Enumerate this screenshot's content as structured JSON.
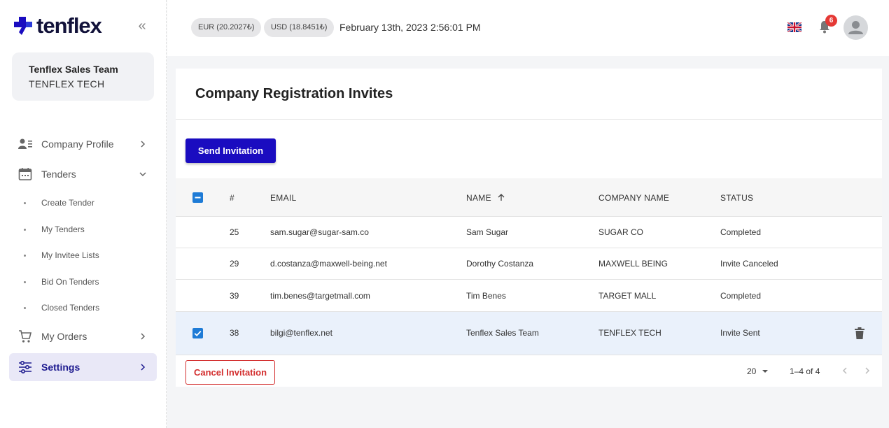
{
  "brand": {
    "name": "tenflex"
  },
  "team": {
    "name": "Tenflex Sales Team",
    "company": "TENFLEX TECH"
  },
  "nav": {
    "company_profile": "Company Profile",
    "tenders": "Tenders",
    "tender_sub": [
      "Create Tender",
      "My Tenders",
      "My Invitee Lists",
      "Bid On Tenders",
      "Closed Tenders"
    ],
    "my_orders": "My Orders",
    "settings": "Settings"
  },
  "topbar": {
    "eur": "EUR (20.2027₺)",
    "usd": "USD (18.8451₺)",
    "datetime": "February 13th, 2023 2:56:01 PM",
    "notification_count": "6"
  },
  "page": {
    "title": "Company Registration Invites",
    "send_label": "Send Invitation",
    "cancel_label": "Cancel Invitation"
  },
  "table": {
    "headers": {
      "num": "#",
      "email": "EMAIL",
      "name": "NAME",
      "company": "COMPANY NAME",
      "status": "STATUS"
    },
    "rows": [
      {
        "num": "25",
        "email": "sam.sugar@sugar-sam.co",
        "name": "Sam Sugar",
        "company": "SUGAR CO",
        "status": "Completed"
      },
      {
        "num": "29",
        "email": "d.costanza@maxwell-being.net",
        "name": "Dorothy Costanza",
        "company": "MAXWELL BEING",
        "status": "Invite Canceled"
      },
      {
        "num": "39",
        "email": "tim.benes@targetmall.com",
        "name": "Tim Benes",
        "company": "TARGET MALL",
        "status": "Completed"
      },
      {
        "num": "38",
        "email": "bilgi@tenflex.net",
        "name": "Tenflex Sales Team",
        "company": "TENFLEX TECH",
        "status": "Invite Sent"
      }
    ]
  },
  "pagination": {
    "page_size": "20",
    "range": "1–4 of 4"
  },
  "colors": {
    "primary": "#1a0cc0",
    "danger": "#d32f2f",
    "checkbox": "#1e7bd6",
    "active_nav_bg": "#e9e8f7",
    "badge": "#e53935"
  }
}
